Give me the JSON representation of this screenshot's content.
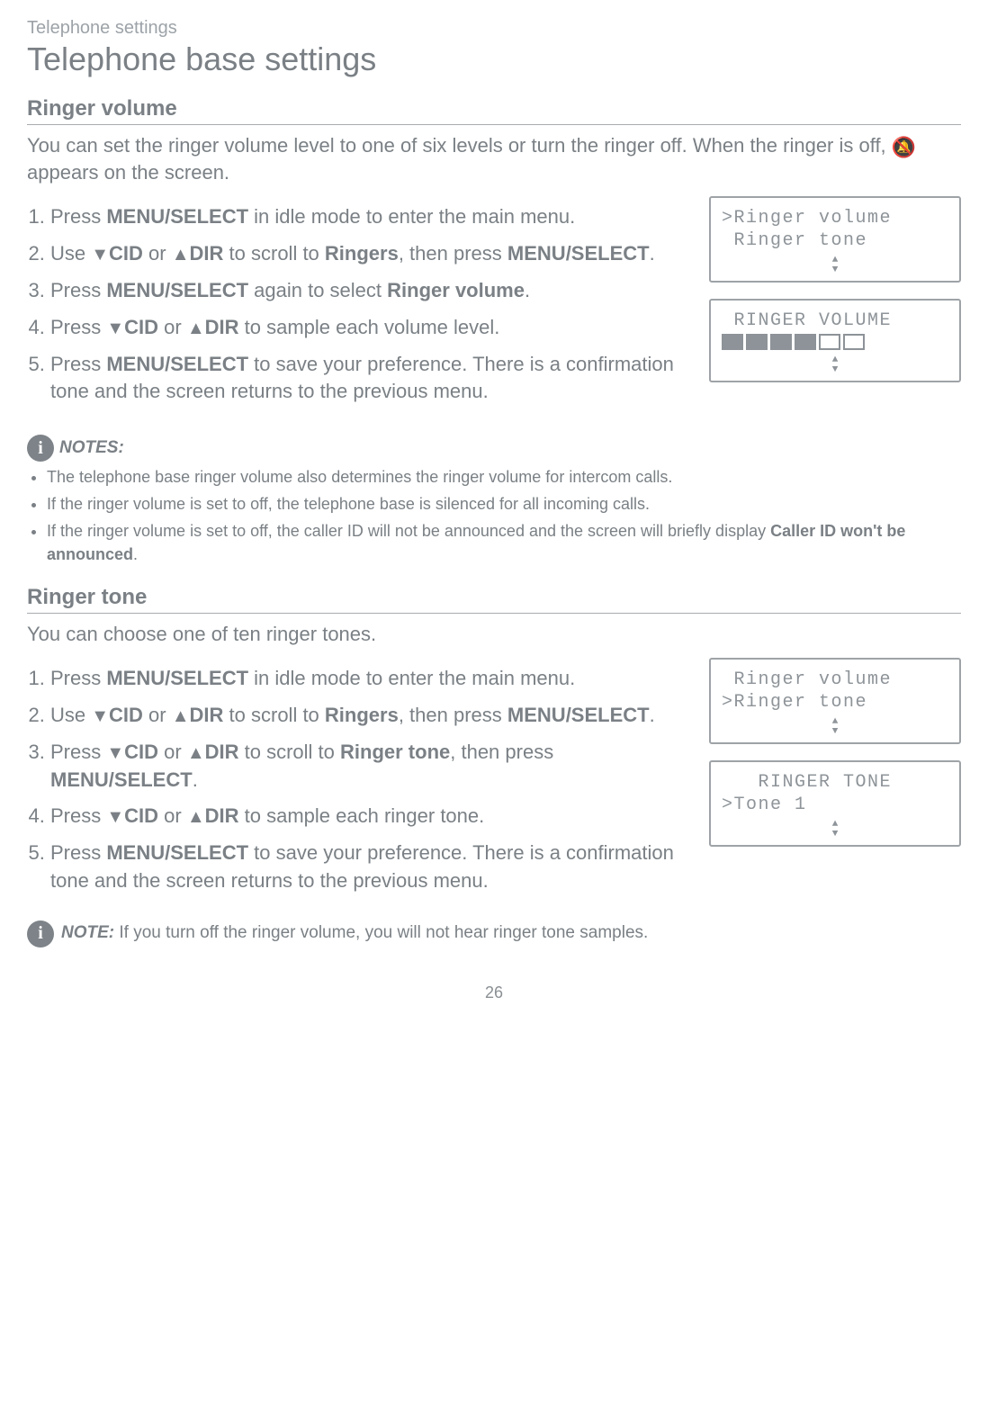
{
  "breadcrumb": "Telephone settings",
  "pageTitle": "Telephone base settings",
  "pageNumber": "26",
  "ringerVolume": {
    "heading": "Ringer volume",
    "intro_pre": "You can set the ringer volume level to one of six levels or turn the ringer off. When the ringer is off, ",
    "intro_post": " appears on the screen.",
    "steps": {
      "s1_a": "Press ",
      "s1_b": "MENU/",
      "s1_c": "SELECT",
      "s1_d": " in idle mode to enter the main menu.",
      "s2_a": "Use ",
      "s2_cid": "CID",
      "s2_or": " or ",
      "s2_dir": "DIR",
      "s2_b": " to scroll to ",
      "s2_c": "Ringers",
      "s2_d": ", then press ",
      "s2_e": "MENU",
      "s2_f": "/SELECT",
      "s2_g": ".",
      "s3_a": "Press ",
      "s3_b": "MENU",
      "s3_c": "/SELECT",
      "s3_d": " again to select ",
      "s3_e": "Ringer volume",
      "s3_f": ".",
      "s4_a": "Press ",
      "s4_cid": "CID",
      "s4_or": " or ",
      "s4_dir": "DIR",
      "s4_b": " to sample each volume level.",
      "s5_a": "Press ",
      "s5_b": "MENU",
      "s5_c": "/SELECT",
      "s5_d": " to save your preference. There is a confirmation tone and the screen returns to the previous menu."
    },
    "notesLabel": "NOTES:",
    "notes": {
      "n1": "The telephone base ringer volume also determines the ringer volume for intercom calls.",
      "n2": "If the ringer volume is set to off, the telephone base is silenced for all incoming calls.",
      "n3a": "If the ringer volume is set to off, the caller ID will not be announced and the screen will briefly display ",
      "n3b": "Caller ID won't be announced",
      "n3c": "."
    },
    "lcd1": {
      "line1": ">Ringer volume",
      "line2": " Ringer tone"
    },
    "lcd2": {
      "title": " RINGER VOLUME",
      "filled": 4,
      "total": 6
    }
  },
  "ringerTone": {
    "heading": "Ringer tone",
    "intro": "You can choose one of ten ringer tones.",
    "steps": {
      "s1_a": "Press ",
      "s1_b": "MENU/",
      "s1_c": "SELECT",
      "s1_d": " in idle mode to enter the main menu.",
      "s2_a": "Use ",
      "s2_cid": "CID",
      "s2_or": " or ",
      "s2_dir": "DIR",
      "s2_b": " to scroll to ",
      "s2_c": "Ringers",
      "s2_d": ", then press ",
      "s2_e": "MENU",
      "s2_f": "/SELECT",
      "s2_g": ".",
      "s3_a": "Press ",
      "s3_cid": "CID",
      "s3_or": " or ",
      "s3_dir": "DIR",
      "s3_b": " to scroll to ",
      "s3_c": "Ringer tone",
      "s3_d": ", then press ",
      "s3_e": "MENU",
      "s3_f": "/SELECT",
      "s3_g": ".",
      "s4_a": "Press ",
      "s4_cid": "CID",
      "s4_or": " or ",
      "s4_dir": "DIR",
      "s4_b": " to sample each ringer tone.",
      "s5_a": "Press ",
      "s5_b": "MENU",
      "s5_c": "/SELECT",
      "s5_d": " to save your preference. There is a confirmation tone and the screen returns to the previous menu."
    },
    "noteLabel": "NOTE:",
    "noteText": " If you turn off the ringer volume, you will not hear ringer tone samples.",
    "lcd1": {
      "line1": " Ringer volume",
      "line2": ">Ringer tone"
    },
    "lcd2": {
      "title": "   RINGER TONE",
      "line2": ">Tone 1"
    }
  }
}
